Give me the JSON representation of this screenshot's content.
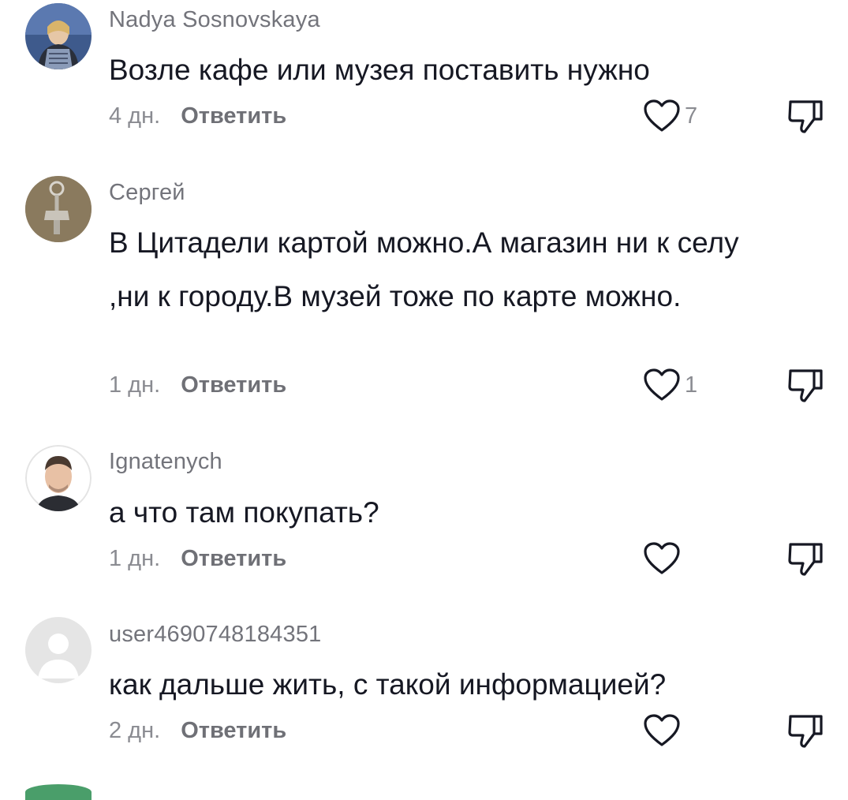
{
  "comments": [
    {
      "username": "Nadya Sosnovskaya",
      "text": "Возле кафе или музея поставить нужно",
      "time": "4 дн.",
      "reply_label": "Ответить",
      "likes": "7"
    },
    {
      "username": "Сергей",
      "text": "В Цитадели картой можно.А магазин ни к селу ,ни к городу.В музей тоже по карте можно.",
      "time": "1 дн.",
      "reply_label": "Ответить",
      "likes": "1"
    },
    {
      "username": "Ignatenych",
      "text": "а что там покупать?",
      "time": "1 дн.",
      "reply_label": "Ответить",
      "likes": ""
    },
    {
      "username": "user4690748184351",
      "text": "как дальше жить, с такой информацией?",
      "time": "2 дн.",
      "reply_label": "Ответить",
      "likes": ""
    }
  ],
  "icons": {
    "like": "heart-outline-icon",
    "dislike": "thumbs-down-icon"
  },
  "colors": {
    "username": "#73747b",
    "text": "#161823",
    "meta": "#8a8b91",
    "icon": "#161823"
  }
}
